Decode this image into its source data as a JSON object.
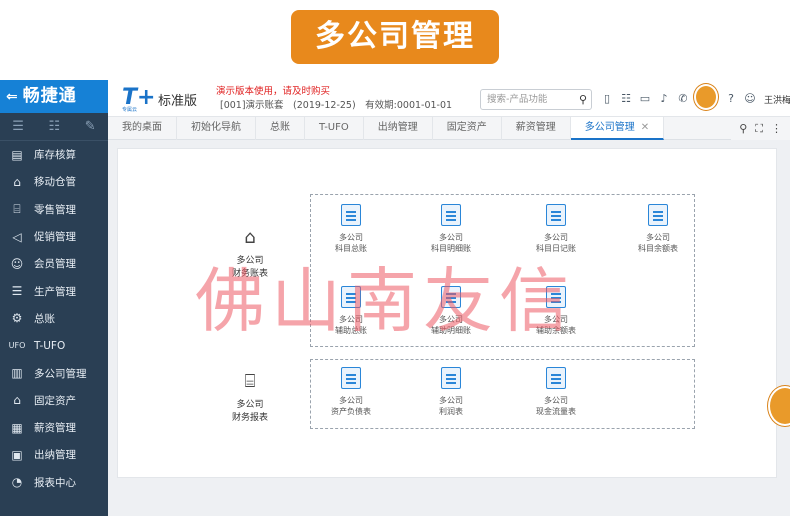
{
  "banner": {
    "title": "多公司管理"
  },
  "brand": {
    "arrow": "⇐",
    "name": "畅捷通"
  },
  "header": {
    "logo": "T+",
    "logo_sub": "专属云",
    "edition": "标准版",
    "warning": "演示版本使用，请及时购买",
    "account": "[001]演示账套　(2019-12-25)　有效期:0001-01-01",
    "search_placeholder": "搜索-产品功能",
    "user": "王洪梅"
  },
  "sidebar": {
    "tools": [
      "☰",
      "☷",
      "✎"
    ],
    "items": [
      {
        "label": "库存核算",
        "icon": "warehouse-icon"
      },
      {
        "label": "移动仓管",
        "icon": "mobile-warehouse-icon"
      },
      {
        "label": "零售管理",
        "icon": "retail-icon"
      },
      {
        "label": "促销管理",
        "icon": "promotion-icon"
      },
      {
        "label": "会员管理",
        "icon": "member-icon"
      },
      {
        "label": "生产管理",
        "icon": "production-icon"
      },
      {
        "label": "总账",
        "icon": "ledger-icon"
      },
      {
        "label": "T-UFO",
        "icon": "ufo-icon"
      },
      {
        "label": "多公司管理",
        "icon": "multi-company-icon"
      },
      {
        "label": "固定资产",
        "icon": "fixed-asset-icon"
      },
      {
        "label": "薪资管理",
        "icon": "salary-icon"
      },
      {
        "label": "出纳管理",
        "icon": "cashier-icon"
      },
      {
        "label": "报表中心",
        "icon": "report-center-icon"
      }
    ]
  },
  "tabs": [
    {
      "label": "我的桌面"
    },
    {
      "label": "初始化导航"
    },
    {
      "label": "总账"
    },
    {
      "label": "T-UFO"
    },
    {
      "label": "出纳管理"
    },
    {
      "label": "固定资产"
    },
    {
      "label": "薪资管理"
    },
    {
      "label": "多公司管理",
      "close": "✕"
    }
  ],
  "groups": {
    "books": {
      "line1": "多公司",
      "line2": "财务账表",
      "tiles": [
        {
          "line1": "多公司",
          "line2": "科目总账"
        },
        {
          "line1": "多公司",
          "line2": "科目明细账"
        },
        {
          "line1": "多公司",
          "line2": "科目日记账"
        },
        {
          "line1": "多公司",
          "line2": "科目余额表"
        },
        {
          "line1": "多公司",
          "line2": "辅助总账"
        },
        {
          "line1": "多公司",
          "line2": "辅助明细账"
        },
        {
          "line1": "多公司",
          "line2": "辅助余额表"
        }
      ]
    },
    "reports": {
      "line1": "多公司",
      "line2": "财务报表",
      "tiles": [
        {
          "line1": "多公司",
          "line2": "资产负债表"
        },
        {
          "line1": "多公司",
          "line2": "利润表"
        },
        {
          "line1": "多公司",
          "line2": "现金流量表"
        }
      ]
    }
  },
  "watermark": "佛山南友信"
}
